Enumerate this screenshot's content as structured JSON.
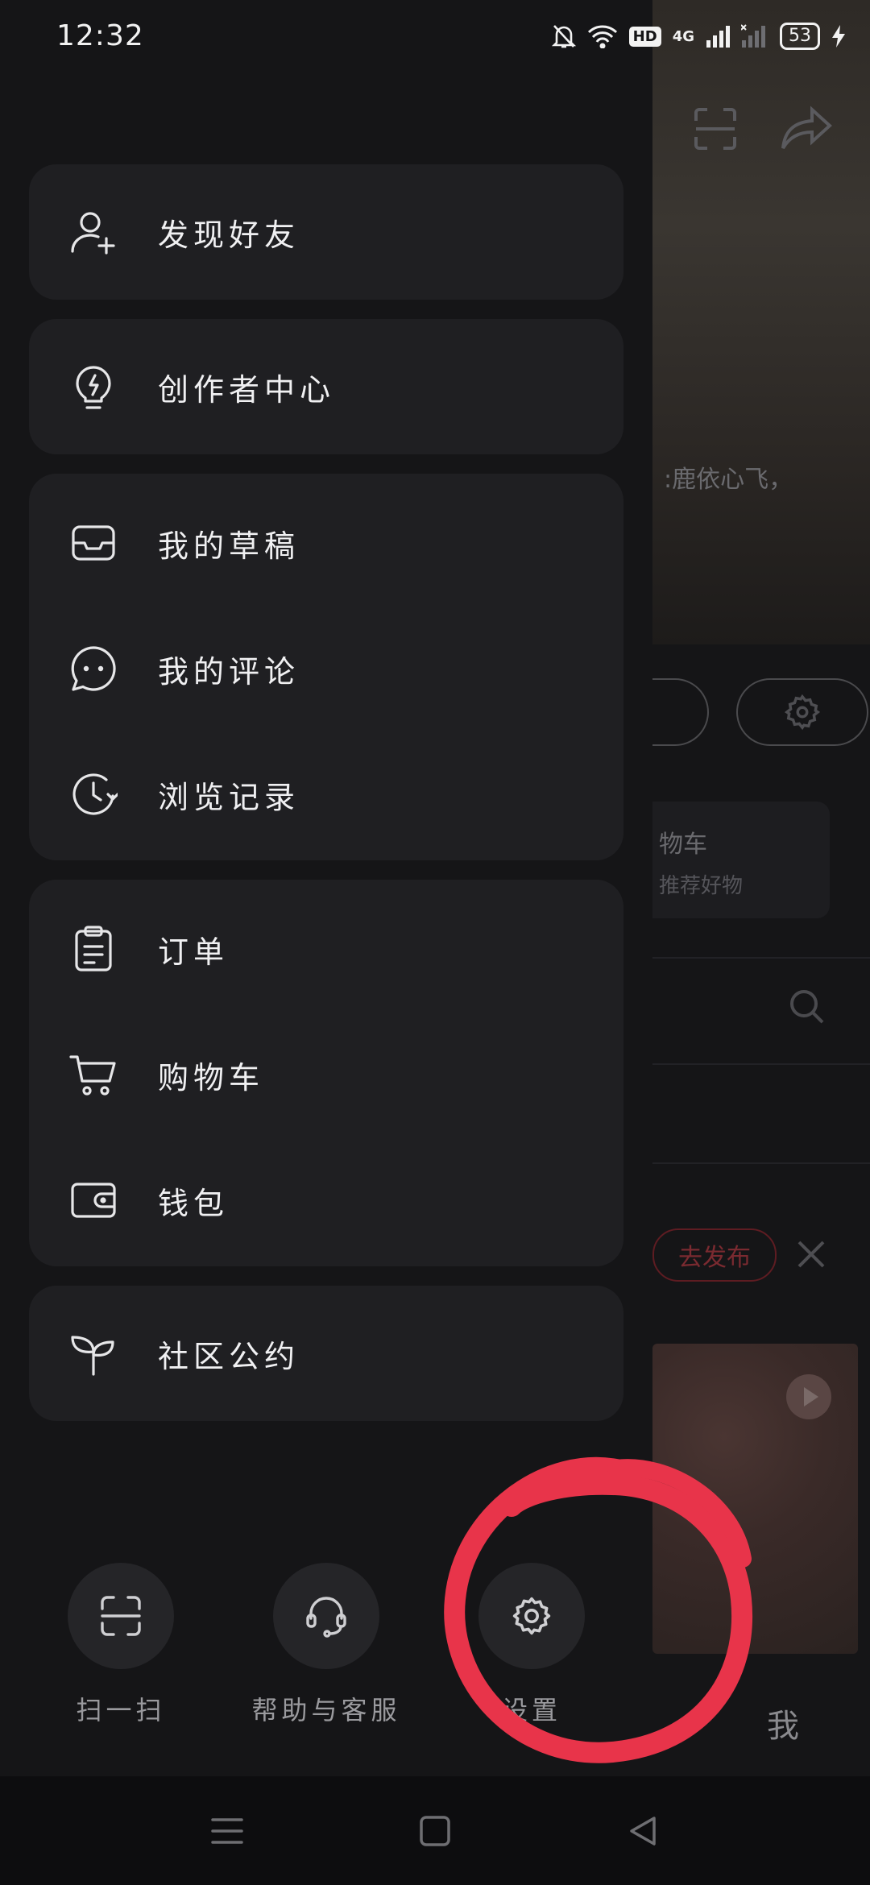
{
  "status_bar": {
    "time": "12:32",
    "network": "4G",
    "hd": "HD",
    "battery": "53"
  },
  "drawer": {
    "groups": [
      {
        "items": [
          {
            "label": "发现好友",
            "icon": "add-user-icon"
          }
        ]
      },
      {
        "items": [
          {
            "label": "创作者中心",
            "icon": "lightning-bulb-icon"
          }
        ]
      },
      {
        "items": [
          {
            "label": "我的草稿",
            "icon": "inbox-tray-icon"
          },
          {
            "label": "我的评论",
            "icon": "chat-bubble-icon"
          },
          {
            "label": "浏览记录",
            "icon": "history-clock-icon"
          }
        ]
      },
      {
        "items": [
          {
            "label": "订单",
            "icon": "clipboard-icon"
          },
          {
            "label": "购物车",
            "icon": "cart-icon"
          },
          {
            "label": "钱包",
            "icon": "wallet-icon"
          }
        ]
      },
      {
        "items": [
          {
            "label": "社区公约",
            "icon": "sprout-icon"
          }
        ]
      }
    ],
    "bottom_actions": [
      {
        "label": "扫一扫",
        "icon": "scan-icon"
      },
      {
        "label": "帮助与客服",
        "icon": "headset-icon"
      },
      {
        "label": "设置",
        "icon": "gear-icon"
      }
    ]
  },
  "background_app": {
    "caption_fragment": ":鹿依心飞，",
    "shopping_title": "物车",
    "shopping_sub": "推荐好物",
    "publish_label": "去发布",
    "tab_me": "我"
  },
  "annotation": {
    "color": "#e8344a",
    "target": "设置"
  }
}
